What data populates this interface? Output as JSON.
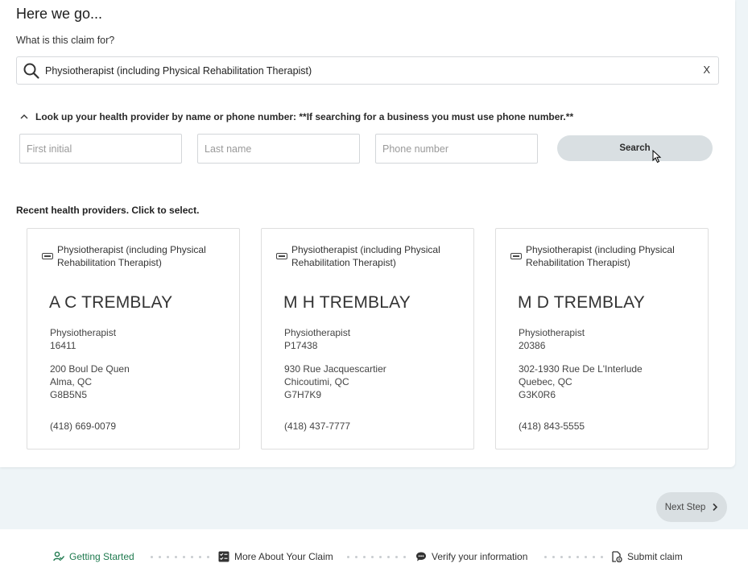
{
  "form": {
    "heading": "Here we go...",
    "question": "What is this claim for?",
    "claim": {
      "value": "Physiotherapist (including Physical Rehabilitation Therapist)",
      "clear_label": "X"
    },
    "lookup_label": "Look up your health provider by name or phone number: **If searching for a business you must use phone number.**",
    "fields": {
      "first_initial_placeholder": "First initial",
      "last_name_placeholder": "Last name",
      "phone_placeholder": "Phone number"
    },
    "search_label": "Search"
  },
  "recent": {
    "label": "Recent health providers. Click to select.",
    "providers": [
      {
        "category_line1": "Physiotherapist (including Physical",
        "category_line2": "Rehabilitation Therapist)",
        "name": "A C TREMBLAY",
        "profession": "Physiotherapist",
        "license": "16411",
        "address1": "200 Boul De Quen",
        "address2": "Alma, QC",
        "address3": "G8B5N5",
        "phone": "(418) 669-0079"
      },
      {
        "category_line1": "Physiotherapist (including Physical",
        "category_line2": "Rehabilitation Therapist)",
        "name": "M H TREMBLAY",
        "profession": "Physiotherapist",
        "license": "P17438",
        "address1": "930 Rue Jacquescartier",
        "address2": "Chicoutimi, QC",
        "address3": "G7H7K9",
        "phone": "(418) 437-7777"
      },
      {
        "category_line1": "Physiotherapist (including Physical",
        "category_line2": "Rehabilitation Therapist)",
        "name": "M D TREMBLAY",
        "profession": "Physiotherapist",
        "license": "20386",
        "address1": "302-1930 Rue De L'Interlude",
        "address2": "Quebec, QC",
        "address3": "G3K0R6",
        "phone": "(418) 843-5555"
      }
    ]
  },
  "next_step_label": "Next Step",
  "progress": {
    "steps": [
      {
        "label": "Getting Started",
        "icon": "person-check-icon",
        "active": true
      },
      {
        "label": "More About Your Claim",
        "icon": "checklist-icon",
        "active": false
      },
      {
        "label": "Verify your information",
        "icon": "chat-bubble-icon",
        "active": false
      },
      {
        "label": "Submit claim",
        "icon": "document-submit-icon",
        "active": false
      }
    ]
  },
  "colors": {
    "page_bg": "#eef4f7",
    "button_bg": "#d9dfe2",
    "active_step": "#1f7a4f"
  }
}
